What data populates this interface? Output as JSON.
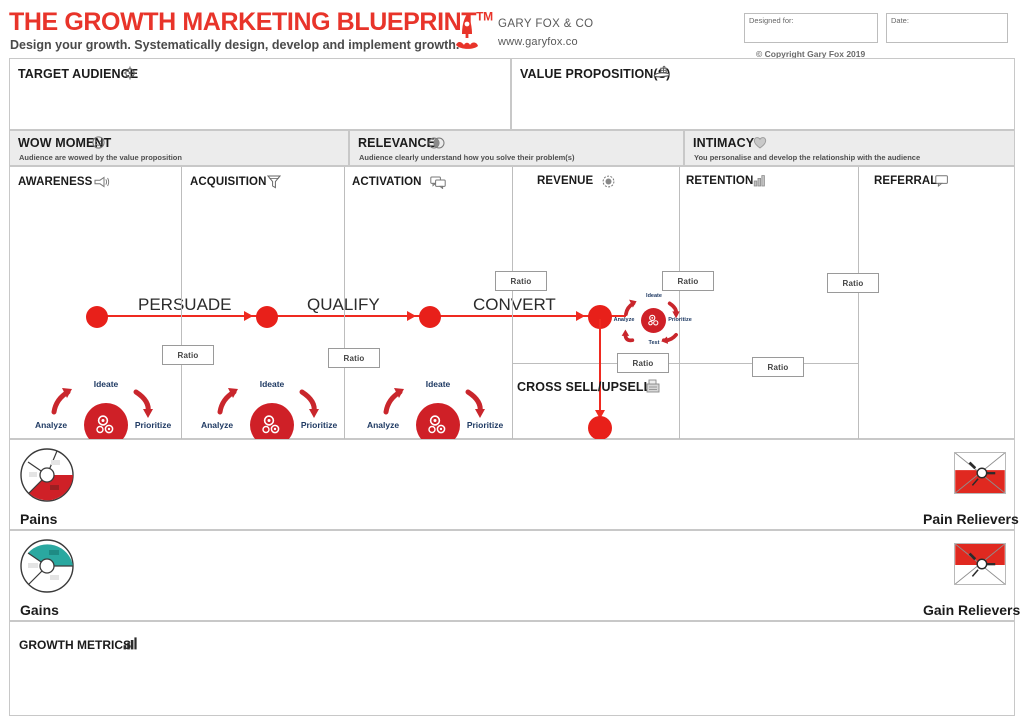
{
  "header": {
    "title": "THE GROWTH MARKETING BLUEPRINT",
    "tm": "TM",
    "subtitle": "Design your growth. Systematically design, develop and implement growth.",
    "brand_name": "GARY FOX & CO",
    "brand_url": "www.garyfox.co",
    "designed_for_label": "Designed for:",
    "designed_for_value": "",
    "date_label": "Date:",
    "date_value": "",
    "copyright": "© Copyright Gary Fox 2019",
    "rocket_icon": "rocket-icon"
  },
  "sections": {
    "target_audience": {
      "title": "TARGET AUDIENCE",
      "icon": "target-crosshair-icon",
      "content": ""
    },
    "value_proposition": {
      "title": "VALUE PROPOSITION(S)",
      "icon": "gift-hand-icon",
      "content": ""
    }
  },
  "bands": [
    {
      "title": "WOW MOMENT",
      "icon": "smiley-icon",
      "subtitle": "Audience are wowed by the value proposition"
    },
    {
      "title": "RELEVANCE",
      "icon": "overlap-circles-icon",
      "subtitle": "Audience clearly understand how you solve their problem(s)"
    },
    {
      "title": "INTIMACY",
      "icon": "heart-icon",
      "subtitle": "You personalise and develop the relationship with the audience"
    }
  ],
  "columns": [
    {
      "title": "AWARENESS",
      "icon": "megaphone-icon"
    },
    {
      "title": "ACQUISITION",
      "icon": "funnel-icon"
    },
    {
      "title": "ACTIVATION",
      "icon": "chat-bubbles-icon"
    },
    {
      "title": "REVENUE",
      "icon": "coin-dollar-icon"
    },
    {
      "title": "RETENTION",
      "icon": "bar-chart-icon"
    },
    {
      "title": "REFERRAL",
      "icon": "speech-bubble-icon"
    }
  ],
  "funnel": {
    "steps": [
      "PERSUADE",
      "QUALIFY",
      "CONVERT"
    ],
    "cross_sell": {
      "title": "CROSS SELL/UPSELL",
      "icon": "cash-register-icon"
    }
  },
  "ratio_label": "Ratio",
  "ratios": [
    {
      "id": "ratio-awareness-acquisition"
    },
    {
      "id": "ratio-acquisition-activation"
    },
    {
      "id": "ratio-activation-revenue"
    },
    {
      "id": "ratio-revenue-retention"
    },
    {
      "id": "ratio-cross-sell"
    },
    {
      "id": "ratio-retention-referral"
    },
    {
      "id": "ratio-referral-bottom"
    }
  ],
  "cycle": {
    "labels": {
      "ideate": "Ideate",
      "prioritize": "Prioritize",
      "test": "Test",
      "analyze": "Analyze"
    },
    "hub_icon": "gears-icon"
  },
  "bottom_rows": [
    {
      "left_label": "Pains",
      "left_icon": "pains-pie-icon",
      "right_label": "Pain Relievers",
      "right_icon": "pain-reliever-icon"
    },
    {
      "left_label": "Gains",
      "left_icon": "gains-pie-icon",
      "right_label": "Gain Relievers",
      "right_icon": "gain-reliever-icon"
    }
  ],
  "growth_metrics": {
    "title": "GROWTH METRICS",
    "icon": "bar-chart-icon",
    "content": ""
  },
  "colors": {
    "brand_red": "#e8342a",
    "dot_red": "#e8201a",
    "hub_red": "#cf2027",
    "cycle_label_blue": "#1f3a63",
    "band_grey": "#ececec",
    "border_grey": "#c8c8c8",
    "teal": "#2aa8a0"
  }
}
